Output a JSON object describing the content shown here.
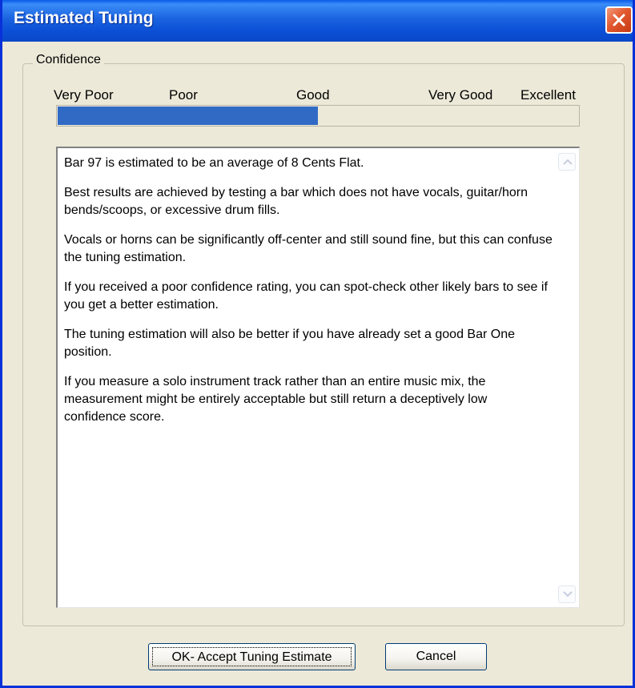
{
  "window": {
    "title": "Estimated Tuning"
  },
  "titlebar_icons": {
    "close": "close-icon"
  },
  "confidence": {
    "legend": "Confidence",
    "labels": [
      "Very Poor",
      "Poor",
      "Good",
      "Very Good",
      "Excellent"
    ],
    "level_fraction": 0.5,
    "fill_color": "#316ac5"
  },
  "message": {
    "paragraphs": [
      "Bar 97 is estimated to be an average of 8 Cents Flat.",
      "Best results are achieved by testing a bar which does not have vocals, guitar/horn bends/scoops, or excessive drum fills.",
      "Vocals or horns can be significantly off-center and still sound fine, but this can confuse the tuning estimation.",
      "If you received a poor confidence rating, you can spot-check other likely bars to see if you get a better estimation.",
      "The tuning estimation will also be better if you have already set a good Bar One position.",
      "If you measure a solo instrument track rather than an entire music mix, the measurement might be entirely acceptable but still return a deceptively low confidence score."
    ],
    "scroll_icons": [
      "scroll-up-icon",
      "scroll-down-icon"
    ]
  },
  "buttons": {
    "ok_label": "OK- Accept Tuning Estimate",
    "cancel_label": "Cancel"
  },
  "colors": {
    "titlebar": "#0b4fd6",
    "dialog_background": "#ece9d8",
    "close_button": "#e2582f"
  }
}
